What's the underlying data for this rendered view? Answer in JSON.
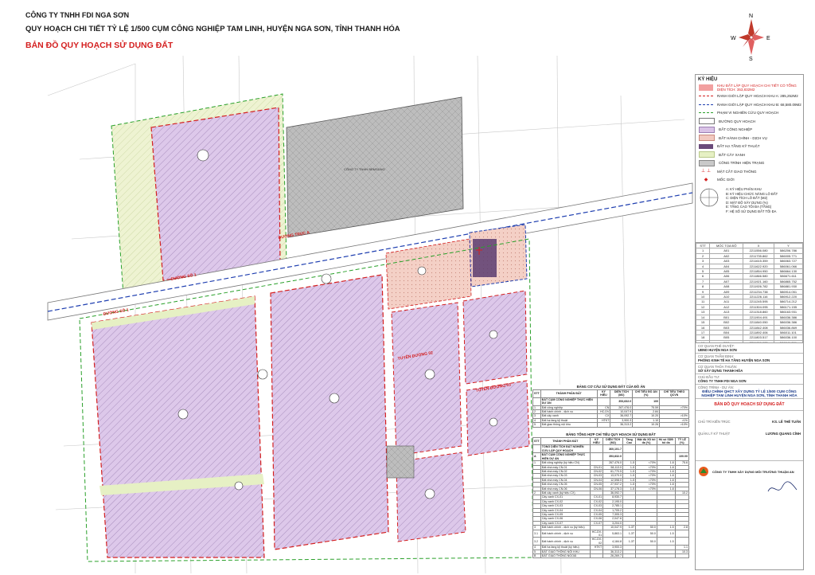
{
  "header": {
    "company": "CÔNG TY TNHH FDI NGA SƠN",
    "project": "QUY HOẠCH CHI TIẾT TỶ LỆ 1/500 CỤM CÔNG NGHIỆP TAM LINH, HUYỆN NGA SƠN, TỈNH THANH HÓA",
    "map_title": "BẢN ĐỒ QUY HOẠCH SỬ DỤNG ĐẤT"
  },
  "compass": {
    "n": "N",
    "s": "S",
    "e": "E",
    "w": "W"
  },
  "map": {
    "road_labels": [
      "ĐƯỜNG TRỤC A",
      "ĐƯỜNG SỐ 1",
      "ĐƯỜNG SỐ 1",
      "TUYẾN ĐƯỜNG 02",
      "TUYẾN ĐƯỜNG 03"
    ],
    "existing_factory_label": "CÔNG TY TNHH BEMSUNG",
    "colors": {
      "industrial": "#d9c2e6",
      "admin": "#f2c9c0",
      "green": "#e6f0c4",
      "existing": "#b7b7b7",
      "tech": "#c8c8e0",
      "border_red": "#d42020",
      "border_blue": "#1f3fb0",
      "border_green": "#2aa02a"
    }
  },
  "legend": {
    "title": "KÝ HIỆU",
    "items": [
      {
        "label": "KHU ĐẤT LẬP QUY HOẠCH CHI TIẾT CÓ TỔNG DIỆN TÍCH: 353,832M2",
        "color": "#f2a0a0",
        "kind": "note"
      },
      {
        "label": "RANH GIỚI LẬP QUY HOẠCH KHU A: 285,252M2",
        "color": "#d42020",
        "kind": "dash"
      },
      {
        "label": "RANH GIỚI LẬP QUY HOẠCH KHU B: 68,580.09M2",
        "color": "#1f3fb0",
        "kind": "dash"
      },
      {
        "label": "PHẠM VI NGHIÊN CỨU QUY HOẠCH",
        "color": "#2aa02a",
        "kind": "dash"
      },
      {
        "label": "ĐƯỜNG QUY HOẠCH",
        "color": "#ffffff",
        "kind": "box"
      },
      {
        "label": "ĐẤT CÔNG NGHIỆP",
        "color": "#d9c2e6",
        "kind": "box"
      },
      {
        "label": "ĐẤT HÀNH CHÍNH - DỊCH VỤ",
        "color": "#f2c9c0",
        "kind": "box"
      },
      {
        "label": "ĐẤT HẠ TẦNG KỸ THUẬT",
        "color": "#6a4a7a",
        "kind": "box"
      },
      {
        "label": "ĐẤT CÂY XANH",
        "color": "#e6f0c4",
        "kind": "box"
      },
      {
        "label": "CÔNG TRÌNH HIỆN TRẠNG",
        "color": "#c9c9c9",
        "kind": "box"
      },
      {
        "label": "MẶT CẮT GIAO THÔNG",
        "color": "#d42020",
        "kind": "sym"
      },
      {
        "label": "MỐC GIỚI",
        "color": "#d42020",
        "kind": "sym"
      }
    ],
    "notes": [
      "A: KÝ HIỆU PHÂN KHU",
      "B: KÝ HIỆU CHỨC NĂNG LÔ ĐẤT",
      "C: DIỆN TÍCH LÔ ĐẤT (M2)",
      "D: MẬT ĐỘ XÂY DỰNG (%)",
      "E: TẦNG CAO TỐI ĐA (TẦNG)",
      "F: HỆ SỐ SỬ DỤNG ĐẤT TỐI ĐA"
    ]
  },
  "coordinates": {
    "headers": [
      "STT",
      "MỐC TỌA ĐỘ",
      "X",
      "Y"
    ],
    "rows": [
      [
        "1",
        "A01",
        "2211556.080",
        "586206.786"
      ],
      [
        "2",
        "A02",
        "2211735.862",
        "586005.771"
      ],
      [
        "3",
        "A03",
        "2211615.359",
        "586063.727"
      ],
      [
        "4",
        "A04",
        "2211622.920",
        "586061.066"
      ],
      [
        "5",
        "A05",
        "2211854.950",
        "586664.130"
      ],
      [
        "6",
        "A06",
        "2211866.580",
        "586671.611"
      ],
      [
        "7",
        "A07",
        "2211921.160",
        "586865.752"
      ],
      [
        "8",
        "A08",
        "2211926.782",
        "586881.930"
      ],
      [
        "9",
        "A09",
        "2211234.738",
        "586914.051"
      ],
      [
        "10",
        "A10",
        "2211226.116",
        "586912.220"
      ],
      [
        "11",
        "A11",
        "2211245.595",
        "586714.212"
      ],
      [
        "12",
        "A12",
        "2211304.095",
        "586171.155"
      ],
      [
        "13",
        "A13",
        "2211318.860",
        "586163.931"
      ],
      [
        "14",
        "B01",
        "2211904.491",
        "586036.386"
      ],
      [
        "15",
        "B02",
        "2211840.050",
        "586036.386"
      ],
      [
        "16",
        "B03",
        "2211842.408",
        "586036.869"
      ],
      [
        "17",
        "B04",
        "2211892.406",
        "586011.101"
      ],
      [
        "18",
        "B05",
        "2211803.517",
        "586036.100"
      ],
      [
        "19",
        "B06",
        "2211806.022",
        "586041.291"
      ],
      [
        "20",
        "B07",
        "2211600.747",
        "586018.570"
      ]
    ]
  },
  "titleblock": {
    "lines": [
      {
        "label": "CƠ QUAN PHÊ DUYỆT:",
        "value": "UBND HUYỆN NGA SƠN"
      },
      {
        "label": "CƠ QUAN THẨM ĐỊNH:",
        "value": "PHÒNG KINH TẾ HẠ TẦNG HUYỆN NGA SƠN"
      },
      {
        "label": "CƠ QUAN THỎA THUẬN:",
        "value": "SỞ XÂY DỰNG THANH HÓA"
      },
      {
        "label": "CHỦ ĐẦU TƯ:",
        "value": "CÔNG TY TNHH FDI NGA SƠN"
      }
    ],
    "project_label": "CÔNG TRÌNH - DỰ ÁN:",
    "project": "ĐIỀU CHỈNH QHCT XÂY DỰNG TỶ LỆ 1/500 CỤM CÔNG NGHIỆP TAM LINH HUYỆN NGA SƠN, TỈNH THANH HÓA",
    "drawing": "BẢN ĐỒ QUY HOẠCH SỬ DỤNG ĐẤT",
    "staff": [
      {
        "label": "CHỦ TRÌ KIẾN TRÚC",
        "value": "KS. LÊ THẾ TUẤN"
      },
      {
        "label": "QUẢN LÝ KỸ THUẬT",
        "value": "LƯƠNG QUANG CÍNH"
      }
    ],
    "consultant": "CÔNG TY TNHH XÂY DỰNG MÔI TRƯỜNG THUẬN AN"
  },
  "table1": {
    "caption": "BẢNG CƠ CẤU SỬ DỤNG ĐẤT CỦA ĐỒ ÁN",
    "headers": [
      "STT",
      "THÀNH PHẦN ĐẤT",
      "KÝ HIỆU",
      "DIỆN TÍCH (M2)",
      "CHỈ TIÊU ĐỒ ÁN (%)",
      "CHỈ TIÊU THEO QCVN"
    ],
    "total": [
      "",
      "ĐẤT CỤM CÔNG NGHIỆP THỰC HIỆN DỰ ÁN",
      "",
      "353,832.0",
      "100",
      ""
    ],
    "rows": [
      [
        "1",
        "Đất công nghiệp",
        "CN",
        "267,476.0",
        "75.59",
        ">70%"
      ],
      [
        "2",
        "Đất hành chính - dịch vụ",
        "HC-DV",
        "10,047.9",
        "2.84",
        ""
      ],
      [
        "3",
        "Đất cây xanh",
        "CX",
        "36,092.7",
        "10.20",
        ">10%"
      ],
      [
        "4",
        "Đất hạ tầng kỹ thuật",
        "HTKT",
        "3,900.3",
        "1.10",
        ">1%"
      ],
      [
        "5",
        "Đất giao thông nội khu",
        "",
        "36,313.2",
        "10.26",
        ">10%"
      ]
    ]
  },
  "table2": {
    "caption": "BẢNG TỔNG HỢP CHỈ TIÊU QUY HOẠCH SỬ DỤNG ĐẤT",
    "headers": [
      "STT",
      "THÀNH PHẦN ĐẤT",
      "KÝ HIỆU",
      "DIỆN TÍCH (M2)",
      "Tầng Cao",
      "Mật độ XD tối đa (%)",
      "Hệ số SDĐ tối đa",
      "TỶ LỆ (%)"
    ],
    "rows": [
      [
        "",
        "TỔNG DIỆN TÍCH ĐẤT NGHIÊN CỨU LẬP QUY HOẠCH",
        "",
        "360,101.7",
        "",
        "",
        "",
        ""
      ],
      [
        "A",
        "ĐẤT CỤM CÔNG NGHIỆP THỰC HIỆN DỰ ÁN",
        "",
        "353,832.0",
        "",
        "",
        "",
        "100.00"
      ],
      [
        "1",
        "Đất công nghiệp (ký hiệu CN)",
        "",
        "267,476.0",
        "1-5",
        "<70%",
        "1.8",
        "75.6"
      ],
      [
        "",
        "Đất nhà máy CN-01",
        "CN-01",
        "58,113.0",
        "1-5",
        "<70%",
        "1.8",
        ""
      ],
      [
        "",
        "Đất nhà máy CN-02",
        "CN-02",
        "61,770.5",
        "1-5",
        "<70%",
        "1.8",
        ""
      ],
      [
        "",
        "Đất nhà máy CN-03",
        "CN-03",
        "13,070.0",
        "1-5",
        "<70%",
        "1.8",
        ""
      ],
      [
        "",
        "Đất nhà máy CN-04",
        "CN-04",
        "12,598.0",
        "1-5",
        "<70%",
        "1.8",
        ""
      ],
      [
        "",
        "Đất nhà máy CN-05",
        "CN-05",
        "27,937.2",
        "1-5",
        "<70%",
        "1.8",
        ""
      ],
      [
        "",
        "Đất nhà máy CN-06",
        "CN-06",
        "37,178.3",
        "1-5",
        "<70%",
        "1.8",
        ""
      ],
      [
        "2",
        "Đất cây xanh (ký hiệu CX)",
        "",
        "36,092.7",
        "",
        "",
        "",
        "10.2"
      ],
      [
        "",
        "Cây xanh CX-01",
        "CX-01",
        "8,930.7",
        "",
        "",
        "",
        ""
      ],
      [
        "",
        "Cây xanh CX-02",
        "CX-02",
        "2,195.0",
        "",
        "",
        "",
        ""
      ],
      [
        "",
        "Cây xanh CX-03",
        "CX-03",
        "2,785.1",
        "",
        "",
        "",
        ""
      ],
      [
        "",
        "Cây xanh CX-04",
        "CX-04",
        "1,705.2",
        "",
        "",
        "",
        ""
      ],
      [
        "",
        "Cây xanh CX-05",
        "CX-05",
        "7,305.3",
        "",
        "",
        "",
        ""
      ],
      [
        "",
        "Cây xanh CX-06",
        "CX-06",
        "2,047.6",
        "",
        "",
        "",
        ""
      ],
      [
        "",
        "Cây xanh CX-07",
        "CX-07",
        "3,204.0",
        "",
        "",
        "",
        ""
      ],
      [
        "3",
        "Đất hành chính - dịch vụ (ký hiệu)",
        "",
        "10,047.9",
        "1-3T",
        "50.0",
        "1.5",
        "2.8"
      ],
      [
        "3.1",
        "Đất hành chính - dịch vụ",
        "HC-DV-01",
        "5,863.1",
        "1-3T",
        "50.0",
        "1.5",
        ""
      ],
      [
        "3.2",
        "Đất hành chính - dịch vụ",
        "HC-DV-02",
        "4,184.8",
        "1-3T",
        "50.0",
        "1.5",
        ""
      ],
      [
        "4",
        "Đất hạ tầng kỹ thuật (ký hiệu)",
        "HTKT",
        "3,900.3",
        "",
        "",
        "",
        "1.1"
      ],
      [
        "5",
        "ĐẤT GIAO THÔNG NỘI KHU",
        "",
        "36,313.2",
        "",
        "",
        "",
        "10.3"
      ],
      [
        "B",
        "ĐẤT GIAO THÔNG NGOÀI",
        "",
        "26,269.7",
        "",
        "",
        "",
        ""
      ]
    ]
  }
}
